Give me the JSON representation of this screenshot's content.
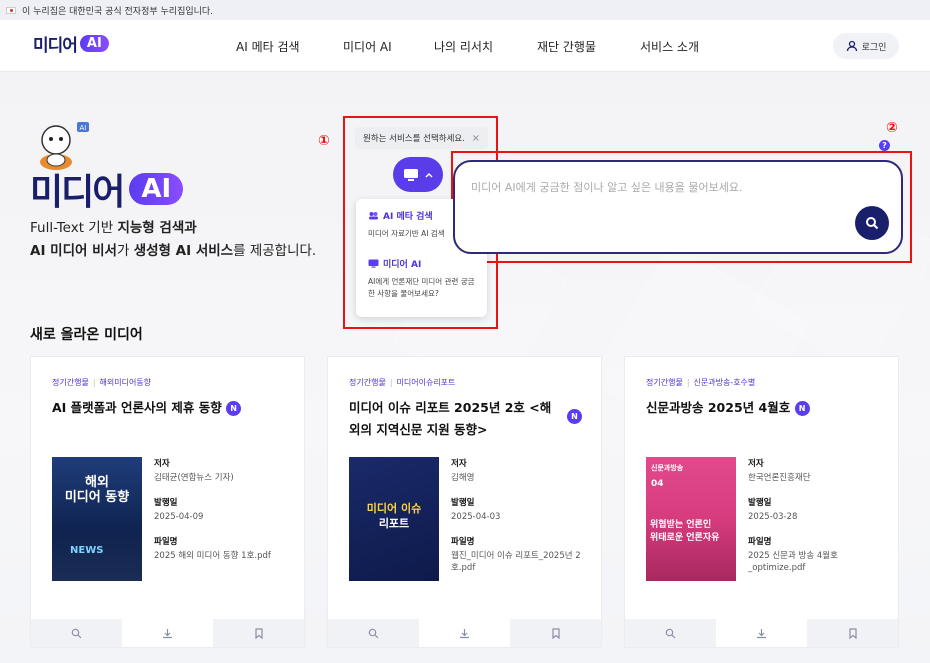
{
  "gov_bar": {
    "text": "이 누리집은 대한민국 공식 전자정부 누리집입니다."
  },
  "header": {
    "logo_text": "미디어",
    "logo_ai": "AI",
    "nav": [
      "AI 메타 검색",
      "미디어 AI",
      "나의 리서치",
      "재단 간행물",
      "서비스 소개"
    ],
    "login_label": "로그인"
  },
  "hero": {
    "logo_text": "미디어",
    "logo_ai": "AI",
    "line1_a": "Full-Text 기반 ",
    "line1_b": "지능형 검색과",
    "line2_a": "AI 미디어 비서",
    "line2_b": "가 ",
    "line2_c": "생성형 AI 서비스",
    "line2_d": "를 제공합니다.",
    "badge_ai": "AI"
  },
  "annotations": {
    "one": "①",
    "two": "②"
  },
  "selector": {
    "tooltip": "원하는 서비스를 선택하세요.",
    "tooltip_close": "×",
    "options": [
      {
        "title": "AI 메타 검색",
        "desc": "미디어 자료기반 AI 검색"
      },
      {
        "title": "미디어 AI",
        "desc": "AI에게 언론재단 미디어 관련 궁금한 사항을 물어보세요?"
      }
    ]
  },
  "search": {
    "placeholder": "미디어 AI에게 궁금한 점이나 알고 싶은 내용을 물어보세요.",
    "help": "?"
  },
  "section_title": "새로 올라온 미디어",
  "cards": [
    {
      "cat1": "정기간행물",
      "cat2": "해외미디어동향",
      "title": "AI 플랫폼과 언론사의 제휴 동향",
      "badge": "N",
      "author_label": "저자",
      "author": "김태균(연합뉴스 기자)",
      "date_label": "발행일",
      "date": "2025-04-09",
      "file_label": "파일명",
      "file": "2025 해외 미디어 동향 1호.pdf",
      "cover_lines": [
        "해외",
        "미디어 동향",
        "NEWS"
      ]
    },
    {
      "cat1": "정기간행물",
      "cat2": "미디어이슈리포트",
      "title": "미디어 이슈 리포트 2025년 2호 <해외의 지역신문 지원 동향>",
      "badge": "N",
      "author_label": "저자",
      "author": "김해영",
      "date_label": "발행일",
      "date": "2025-04-03",
      "file_label": "파일명",
      "file": "웹진_미디어 이슈 리포트_2025년 2호.pdf",
      "cover_lines": [
        "미디어 이슈",
        "리포트"
      ]
    },
    {
      "cat1": "정기간행물",
      "cat2": "신문과방송-호수별",
      "title": "신문과방송 2025년 4월호",
      "badge": "N",
      "author_label": "저자",
      "author": "한국언론진흥재단",
      "date_label": "발행일",
      "date": "2025-03-28",
      "file_label": "파일명",
      "file": "2025 신문과 방송 4월호_optimize.pdf",
      "cover_lines": [
        "신문과방송",
        "04",
        "위협받는 언론인",
        "위태로운 언론자유"
      ]
    }
  ]
}
